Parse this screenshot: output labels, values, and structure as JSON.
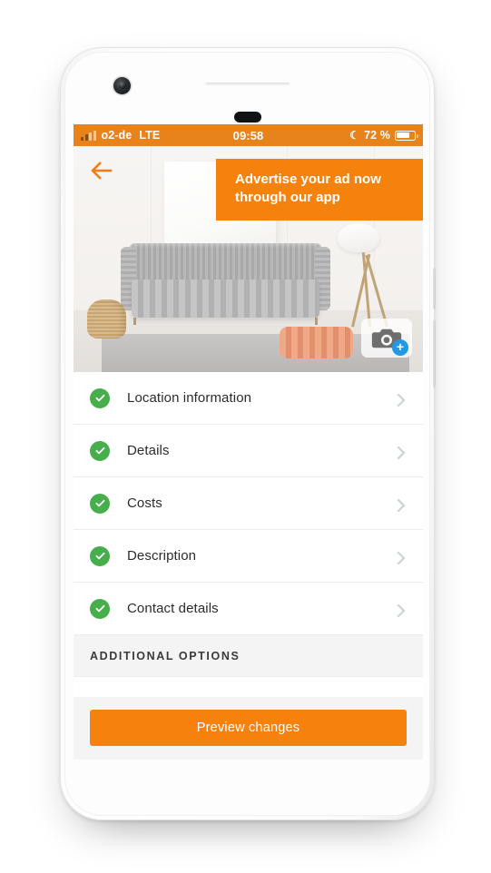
{
  "status_bar": {
    "signal_icon": "signal-bars-icon",
    "carrier": "o2-de",
    "network": "LTE",
    "time": "09:58",
    "moon_icon": "moon-icon",
    "battery_percent": "72 %",
    "battery_icon": "battery-icon",
    "background_color": "#e8821a"
  },
  "hero": {
    "back_icon": "back-arrow-icon",
    "photo_alt": "living room with grey sofa",
    "camera_icon": "camera-icon",
    "add_photo_badge": "+",
    "banner": {
      "line1": "Advertise your ad now",
      "line2": "through our app",
      "background_color": "#f5820d"
    }
  },
  "list": {
    "check_icon": "check-circle-icon",
    "chevron_icon": "chevron-right-icon",
    "check_color": "#46ae4b",
    "items": [
      {
        "label": "Location information"
      },
      {
        "label": "Details"
      },
      {
        "label": "Costs"
      },
      {
        "label": "Description"
      },
      {
        "label": "Contact details"
      }
    ]
  },
  "section": {
    "additional_options_label": "ADDITIONAL OPTIONS"
  },
  "footer": {
    "preview_button_label": "Preview changes",
    "preview_button_color": "#f5820d"
  }
}
